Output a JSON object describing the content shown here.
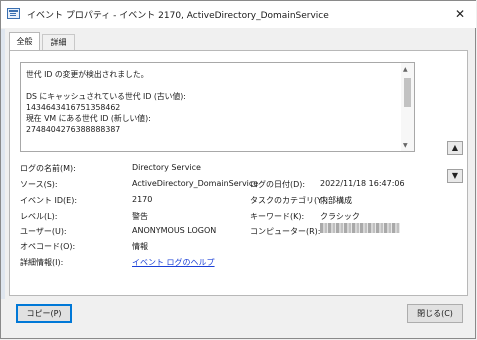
{
  "window": {
    "title": "イベント プロパティ - イベント 2170, ActiveDirectory_DomainService",
    "close_glyph": "✕"
  },
  "tabs": [
    {
      "label": "全般",
      "selected": true
    },
    {
      "label": "詳細",
      "selected": false
    }
  ],
  "message": {
    "text": "世代 ID の変更が検出されました。\n\nDS にキャッシュされている世代 ID (古い値):\n1434643416751358462\n現在 VM にある世代 ID (新しい値):\n2748404276388888387"
  },
  "side_buttons": {
    "up_glyph": "▲",
    "down_glyph": "▼"
  },
  "properties": {
    "log_name_label": "ログの名前(M):",
    "log_name_value": "Directory Service",
    "source_label": "ソース(S):",
    "source_value": "ActiveDirectory_DomainService",
    "logged_label": "ログの日付(D):",
    "logged_value": "2022/11/18 16:47:06",
    "event_id_label": "イベント ID(E):",
    "event_id_value": "2170",
    "task_category_label": "タスクのカテゴリ(Y):",
    "task_category_value": "内部構成",
    "level_label": "レベル(L):",
    "level_value": "警告",
    "keywords_label": "キーワード(K):",
    "keywords_value": "クラシック",
    "user_label": "ユーザー(U):",
    "user_value": "ANONYMOUS LOGON",
    "computer_label": "コンピューター(R):",
    "opcode_label": "オペコード(O):",
    "opcode_value": "情報",
    "more_info_label": "詳細情報(I):",
    "more_info_link": "イベント ログのヘルプ"
  },
  "buttons": {
    "copy": "コピー(P)",
    "close": "閉じる(C)"
  }
}
